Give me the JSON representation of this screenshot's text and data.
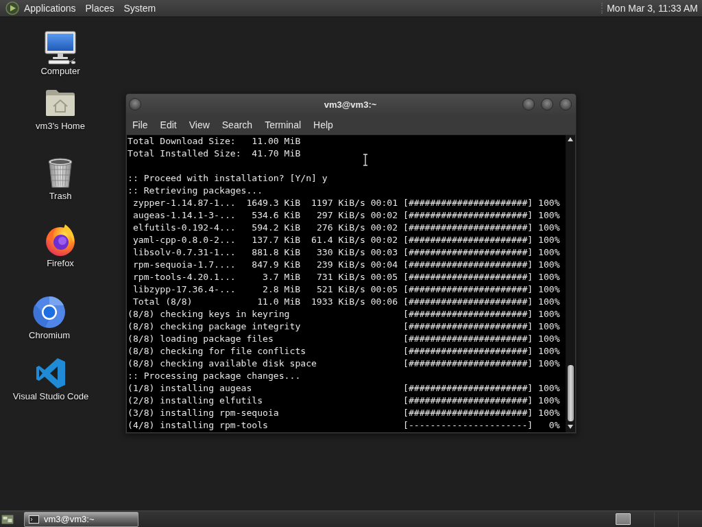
{
  "top_panel": {
    "menus": [
      "Applications",
      "Places",
      "System"
    ],
    "clock": "Mon Mar 3, 11:33 AM"
  },
  "desktop_icons": [
    {
      "kind": "computer",
      "label": "Computer"
    },
    {
      "kind": "home",
      "label": "vm3's Home"
    },
    {
      "kind": "trash",
      "label": "Trash"
    },
    {
      "kind": "firefox",
      "label": "Firefox"
    },
    {
      "kind": "chromium",
      "label": "Chromium"
    },
    {
      "kind": "vscode",
      "label": "Visual Studio Code"
    }
  ],
  "terminal_window": {
    "title": "vm3@vm3:~",
    "menu": [
      "File",
      "Edit",
      "View",
      "Search",
      "Terminal",
      "Help"
    ],
    "lines": [
      {
        "kind": "text",
        "text": "Total Download Size:   11.00 MiB"
      },
      {
        "kind": "text",
        "text": "Total Installed Size:  41.70 MiB"
      },
      {
        "kind": "blank"
      },
      {
        "kind": "text",
        "text": ":: Proceed with installation? [Y/n] y"
      },
      {
        "kind": "text",
        "text": ":: Retrieving packages..."
      },
      {
        "kind": "package",
        "name": "zypper-1.14.87-1...",
        "size": "1649.3 KiB",
        "rate": "1197 KiB/s",
        "time": "00:01",
        "bar": "[######################]",
        "percent": "100%"
      },
      {
        "kind": "package",
        "name": "augeas-1.14.1-3-...",
        "size": "534.6 KiB",
        "rate": "297 KiB/s",
        "time": "00:02",
        "bar": "[######################]",
        "percent": "100%"
      },
      {
        "kind": "package",
        "name": "elfutils-0.192-4...",
        "size": "594.2 KiB",
        "rate": "276 KiB/s",
        "time": "00:02",
        "bar": "[######################]",
        "percent": "100%"
      },
      {
        "kind": "package",
        "name": "yaml-cpp-0.8.0-2...",
        "size": "137.7 KiB",
        "rate": "61.4 KiB/s",
        "time": "00:02",
        "bar": "[######################]",
        "percent": "100%"
      },
      {
        "kind": "package",
        "name": "libsolv-0.7.31-1...",
        "size": "881.8 KiB",
        "rate": "330 KiB/s",
        "time": "00:03",
        "bar": "[######################]",
        "percent": "100%"
      },
      {
        "kind": "package",
        "name": "rpm-sequoia-1.7....",
        "size": "847.9 KiB",
        "rate": "239 KiB/s",
        "time": "00:04",
        "bar": "[######################]",
        "percent": "100%"
      },
      {
        "kind": "package",
        "name": "rpm-tools-4.20.1...",
        "size": "3.7 MiB",
        "rate": "731 KiB/s",
        "time": "00:05",
        "bar": "[######################]",
        "percent": "100%"
      },
      {
        "kind": "package",
        "name": "libzypp-17.36.4-...",
        "size": "2.8 MiB",
        "rate": "521 KiB/s",
        "time": "00:05",
        "bar": "[######################]",
        "percent": "100%"
      },
      {
        "kind": "package",
        "name": "Total (8/8)",
        "size": "11.0 MiB",
        "rate": "1933 KiB/s",
        "time": "00:06",
        "bar": "[######################]",
        "percent": "100%"
      },
      {
        "kind": "step",
        "text": "(8/8) checking keys in keyring",
        "bar": "[######################]",
        "percent": "100%"
      },
      {
        "kind": "step",
        "text": "(8/8) checking package integrity",
        "bar": "[######################]",
        "percent": "100%"
      },
      {
        "kind": "step",
        "text": "(8/8) loading package files",
        "bar": "[######################]",
        "percent": "100%"
      },
      {
        "kind": "step",
        "text": "(8/8) checking for file conflicts",
        "bar": "[######################]",
        "percent": "100%"
      },
      {
        "kind": "step",
        "text": "(8/8) checking available disk space",
        "bar": "[######################]",
        "percent": "100%"
      },
      {
        "kind": "text",
        "text": ":: Processing package changes..."
      },
      {
        "kind": "step",
        "text": "(1/8) installing augeas",
        "bar": "[######################]",
        "percent": "100%"
      },
      {
        "kind": "step",
        "text": "(2/8) installing elfutils",
        "bar": "[######################]",
        "percent": "100%"
      },
      {
        "kind": "step",
        "text": "(3/8) installing rpm-sequoia",
        "bar": "[######################]",
        "percent": "100%"
      },
      {
        "kind": "step",
        "text": "(4/8) installing rpm-tools",
        "bar": "[----------------------]",
        "percent": "0%"
      }
    ]
  },
  "bottom_panel": {
    "tasks": [
      {
        "label": "vm3@vm3:~",
        "selected": true
      }
    ]
  }
}
